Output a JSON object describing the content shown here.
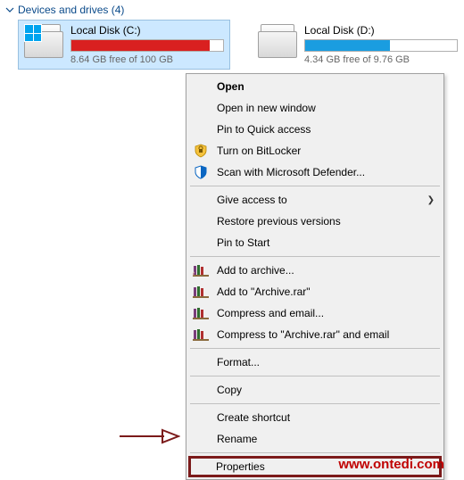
{
  "header": {
    "title": "Devices and drives (4)"
  },
  "drives": [
    {
      "name": "Local Disk (C:)",
      "sub": "8.64 GB free of 100 GB",
      "fill_percent": 91,
      "color": "red",
      "has_winlogo": true
    },
    {
      "name": "Local Disk (D:)",
      "sub": "4.34 GB free of 9.76 GB",
      "fill_percent": 56,
      "color": "blue",
      "has_winlogo": false
    }
  ],
  "context_menu": {
    "open": "Open",
    "open_new_window": "Open in new window",
    "pin_quick_access": "Pin to Quick access",
    "bitlocker": "Turn on BitLocker",
    "defender": "Scan with Microsoft Defender...",
    "give_access": "Give access to",
    "restore": "Restore previous versions",
    "pin_start": "Pin to Start",
    "add_archive": "Add to archive...",
    "add_archive_rar": "Add to \"Archive.rar\"",
    "compress_email": "Compress and email...",
    "compress_archive_email": "Compress to \"Archive.rar\" and email",
    "format": "Format...",
    "copy": "Copy",
    "create_shortcut": "Create shortcut",
    "rename": "Rename",
    "properties": "Properties"
  },
  "watermark": "www.ontedi.com"
}
